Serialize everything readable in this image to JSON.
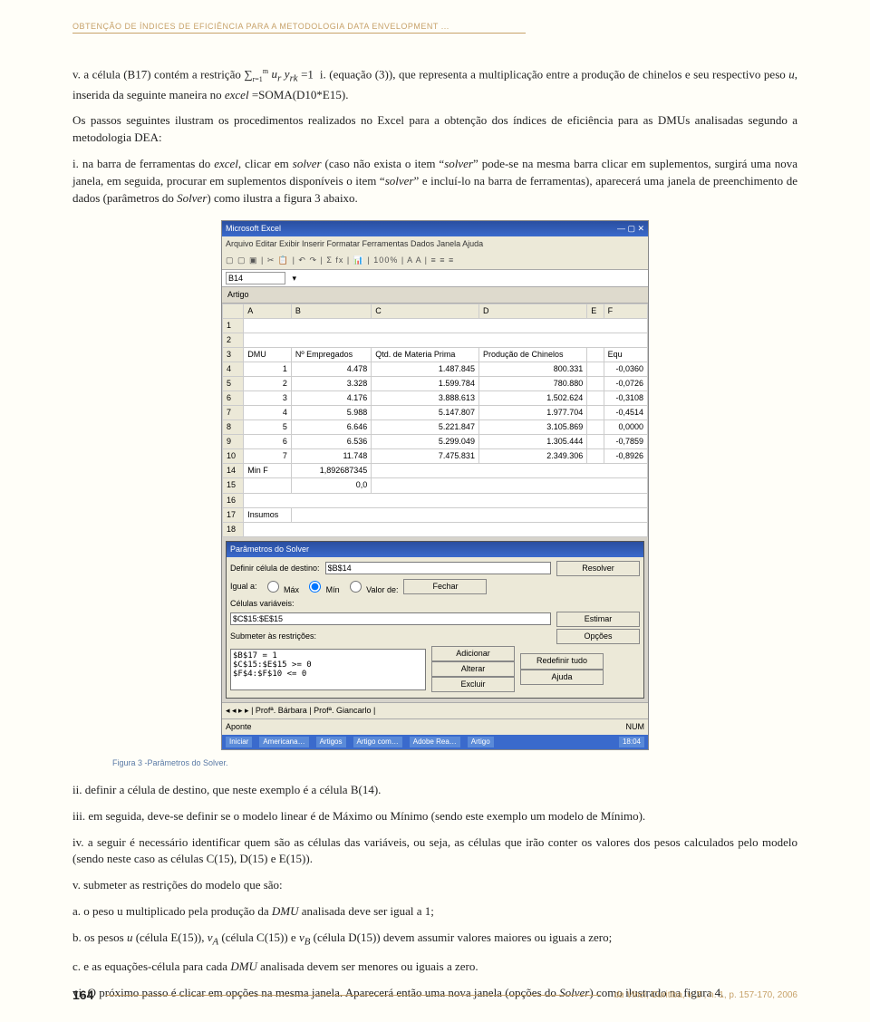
{
  "header": {
    "running": "OBTENÇÃO DE ÍNDICES DE EFICIÊNCIA PARA A METODOLOGIA DATA ENVELOPMENT ..."
  },
  "body": {
    "p_ospassos": "Os passos seguintes ilustram os procedimentos realizados no Excel para a obtenção dos índices de eficiência para as DMUs analisadas segundo a metodologia DEA:",
    "figcap": "Figura 3 -Parâmetros do Solver.",
    "p_ii": "ii. definir a célula de destino, que neste exemplo é a célula B(14).",
    "p_iii": "iii. em seguida, deve-se definir se o modelo linear é de Máximo ou Mínimo (sendo este exemplo um modelo de Mínimo).",
    "p_iv": "iv. a seguir é necessário identificar quem são as células das variáveis, ou seja, as células que irão conter os valores dos pesos calculados pelo modelo (sendo neste caso as células C(15), D(15) e E(15)).",
    "p_v": "v. submeter as restrições do modelo que são:"
  },
  "screenshot": {
    "title": "Microsoft Excel",
    "menubar": "Arquivo  Editar  Exibir  Inserir  Formatar  Ferramentas  Dados  Janela  Ajuda",
    "toolbar": "▢ ▢ ▣ | ✂ 📋 | ↶ ↷ | Σ fx | 📊 | 100% | A A | ≡ ≡ ≡",
    "namebox": "B14",
    "workbook": "Artigo",
    "headers": [
      "DMU",
      "Nº Empregados",
      "Qtd. de Materia Prima",
      "Produção de Chinelos",
      "Equ"
    ],
    "rows": [
      [
        "1",
        "4.478",
        "1.487.845",
        "800.331",
        "-0,0360"
      ],
      [
        "2",
        "3.328",
        "1.599.784",
        "780.880",
        "-0,0726"
      ],
      [
        "3",
        "4.176",
        "3.888.613",
        "1.502.624",
        "-0,3108"
      ],
      [
        "4",
        "5.988",
        "5.147.807",
        "1.977.704",
        "-0,4514"
      ],
      [
        "5",
        "6.646",
        "5.221.847",
        "3.105.869",
        "0,0000"
      ],
      [
        "6",
        "6.536",
        "5.299.049",
        "1.305.444",
        "-0,7859"
      ],
      [
        "7",
        "11.748",
        "7.475.831",
        "2.349.306",
        "-0,8926"
      ]
    ],
    "row14": [
      "Min F",
      "1,892687345"
    ],
    "row15": [
      "",
      "0,0"
    ],
    "row17": [
      "Insumos",
      ""
    ],
    "solver": {
      "title": "Parâmetros do Solver",
      "l_target": "Definir célula de destino:",
      "target": "$B$14",
      "l_equal": "Igual a:",
      "opt_max": "Máx",
      "opt_min": "Mín",
      "opt_val": "Valor de:",
      "l_vars": "Células variáveis:",
      "vars": "$C$15:$E$15",
      "l_constraints": "Submeter às restrições:",
      "constraints": "$B$17 = 1\n$C$15:$E$15 >= 0\n$F$4:$F$10 <= 0",
      "btn_solve": "Resolver",
      "btn_close": "Fechar",
      "btn_guess": "Estimar",
      "btn_options": "Opções",
      "btn_add": "Adicionar",
      "btn_change": "Alterar",
      "btn_delete": "Excluir",
      "btn_reset": "Redefinir tudo",
      "btn_help": "Ajuda"
    },
    "sheets": "◂ ◂ ▸ ▸ | Profª. Bárbara | Profª. Giancarlo |",
    "status_left": "Aponte",
    "status_right": "NUM",
    "taskbar": [
      "Iniciar",
      "Americana…",
      "Artigos",
      "Artigo com…",
      "Adobe Rea…",
      "Artigo"
    ],
    "clock": "18:04"
  },
  "footer": {
    "page": "164",
    "journal": "da Vinci",
    "cite": ", Curitiba, v. 3 , n. 1, p. 157-170, 2006"
  }
}
